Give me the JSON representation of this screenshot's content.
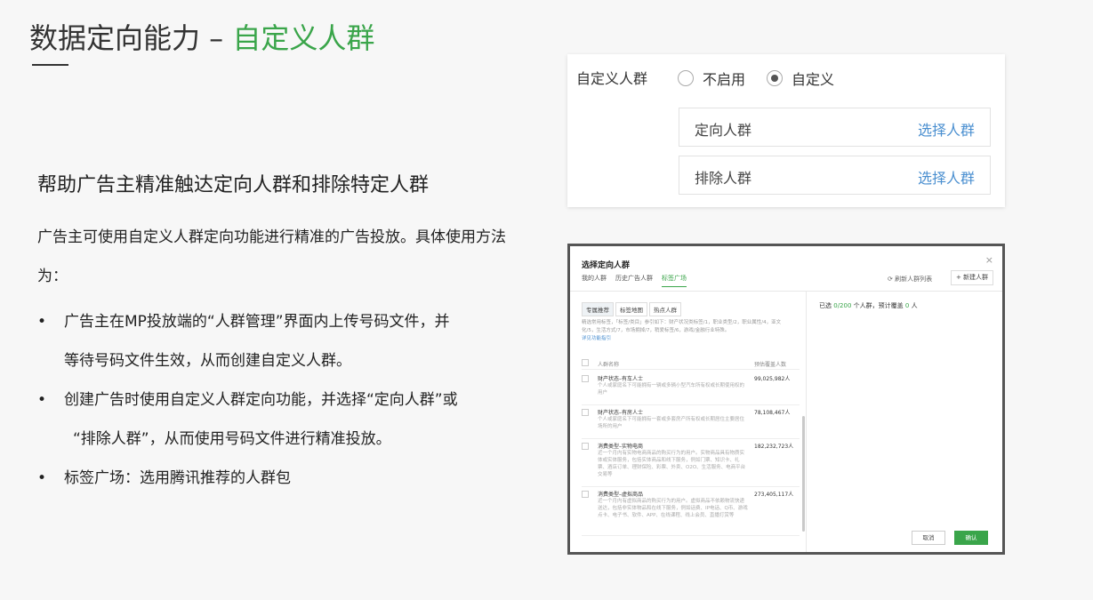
{
  "header": {
    "title_main": "数据定向能力 – ",
    "title_accent": "自定义人群"
  },
  "body": {
    "subtitle": "帮助广告主精准触达定向人群和排除特定人群",
    "intro": "广告主可使用自定义人群定向功能进行精准的广告投放。具体使用方法为：",
    "bullet_marker": "•",
    "bullets": [
      {
        "line1": "广告主在MP投放端的“人群管理”界面内上传号码文件，并",
        "line2": "等待号码文件生效，从而创建自定义人群。"
      },
      {
        "line1": "创建广告时使用自定义人群定向功能，并选择“定向人群”或",
        "line2": "“排除人群”，从而使用号码文件进行精准投放。"
      },
      {
        "line1": "标签广场：选用腾讯推荐的人群包"
      }
    ]
  },
  "panel1": {
    "label": "自定义人群",
    "radio_off": "不启用",
    "radio_on": "自定义",
    "field1_label": "定向人群",
    "field1_action": "选择人群",
    "field2_label": "排除人群",
    "field2_action": "选择人群"
  },
  "modal": {
    "title": "选择定向人群",
    "close": "×",
    "tabs": [
      "我的人群",
      "历史广告人群",
      "标签广场"
    ],
    "refresh": "⟳ 刷新人群列表",
    "new_button": "+ 新建人群",
    "subtabs": [
      "专属推荐",
      "标签地图",
      "热点人群"
    ],
    "desc": "精选常用标签，「标签/类目」参引如下：财产状况类标签/1，职业类型/2，职业属性/4，亚文化/5，生活方式/7，市场拥掉/7，稍爱标签/6，游戏/金融行业特殊。",
    "desc_link": "详见功能指引",
    "col_name": "人群名称",
    "col_count": "预估覆盖人数",
    "rows": [
      {
        "name": "财产状态–有车人士",
        "count": "99,025,982人",
        "desc": "个人或家庭名下可能拥有一辆或多辆小型汽车所有权或长期使用权的用户"
      },
      {
        "name": "财产状态–有房人士",
        "count": "78,108,467人",
        "desc": "个人或家庭名下可能拥有一套或多套房产所有权或长期居住主要居住场所的用户"
      },
      {
        "name": "消费类型–实物电商",
        "count": "182,232,723人",
        "desc": "近一个月内有实物电商商品的购买行为的用户。实物商品具有物质实体或实体服务，包括实体商品和线下服务，例如门票、知识卡、礼票、酒店订单、理财保险、彩票、外卖、O2O、生活服务、电商平台交易等"
      },
      {
        "name": "消费类型–虚拟商品",
        "count": "273,405,117人",
        "desc": "近一个月内有虚拟商品的购买行为的用户。虚拟商品不依赖物流快递送达，包括非实体物品和在线下服务，例如话费、IP电话、Q币、游戏点卡、电子书、软件、APP、在线课程、线上会员、直播打赏等"
      }
    ],
    "selected_prefix": "已选 ",
    "selected_count": "0/200",
    "selected_mid": " 个人群，预计覆盖 ",
    "coverage": "0",
    "selected_suffix": " 人",
    "cancel": "取消",
    "confirm": "确认"
  }
}
